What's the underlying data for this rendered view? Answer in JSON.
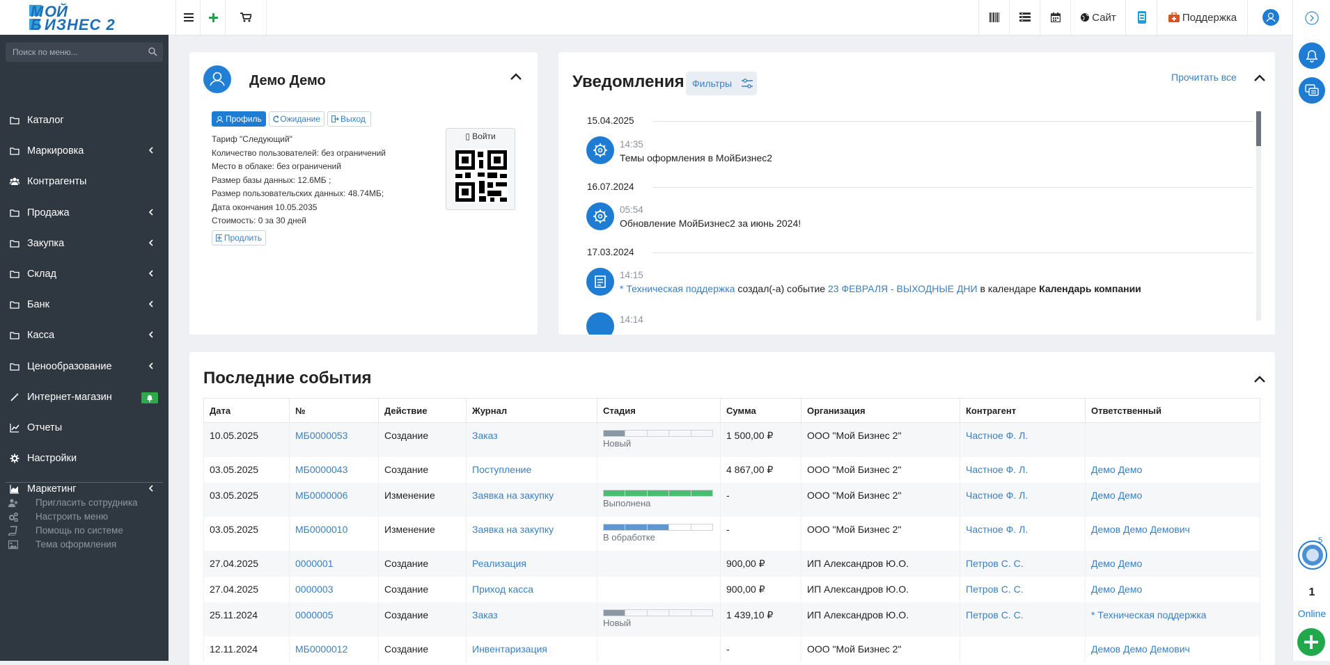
{
  "topbar": {
    "site_label": "Сайт",
    "support_label": "Поддержка"
  },
  "sidebar": {
    "search_placeholder": "Поиск по меню...",
    "items": [
      {
        "label": "Каталог",
        "icon": "folder-icon",
        "chevron": false
      },
      {
        "label": "Маркировка",
        "icon": "folder-icon",
        "chevron": true
      },
      {
        "label": "Контрагенты",
        "icon": "users-icon",
        "chevron": false
      },
      {
        "label": "Продажа",
        "icon": "folder-icon",
        "chevron": true
      },
      {
        "label": "Закупка",
        "icon": "folder-icon",
        "chevron": true
      },
      {
        "label": "Склад",
        "icon": "folder-icon",
        "chevron": true
      },
      {
        "label": "Банк",
        "icon": "folder-icon",
        "chevron": true
      },
      {
        "label": "Касса",
        "icon": "folder-icon",
        "chevron": true
      },
      {
        "label": "Ценообразование",
        "icon": "folder-icon",
        "chevron": true
      },
      {
        "label": "Интернет-магазин",
        "icon": "magic-wand-icon",
        "chevron": false
      },
      {
        "label": "Отчеты",
        "icon": "line-chart-icon",
        "chevron": false
      },
      {
        "label": "Настройки",
        "icon": "gear-icon",
        "chevron": false
      },
      {
        "label": "Маркетинг",
        "icon": "area-chart-icon",
        "chevron": true
      }
    ],
    "sub_items": [
      {
        "label": "Пригласить сотрудника",
        "icon": "user-plus-icon"
      },
      {
        "label": "Настроить меню",
        "icon": "gears-icon"
      },
      {
        "label": "Помощь по системе",
        "icon": "book-icon"
      },
      {
        "label": "Тема оформления",
        "icon": "image-icon"
      }
    ]
  },
  "profile": {
    "name": "Демо Демо",
    "btn_profile": "Профиль",
    "btn_wait": "Ожидание",
    "btn_exit": "Выход",
    "lines": [
      "Тариф \"Следующий\"",
      "Количество пользователей: без ограничений",
      "Место в облаке: без ограничений",
      "Размер базы данных: 12.6МБ ;",
      "Размер пользовательских данных: 48.74МБ;",
      "Дата окончания 10.05.2035",
      "Стоимость: 0 за 30 дней"
    ],
    "btn_extend": "Продлить",
    "qr_label": "Войти"
  },
  "notifications": {
    "title": "Уведомления",
    "filters_label": "Фильтры",
    "read_all": "Прочитать все",
    "groups": [
      {
        "date": "15.04.2025",
        "time": "14:35",
        "text": "Темы оформления в МойБизнес2"
      },
      {
        "date": "16.07.2024",
        "time": "05:54",
        "text": "Обновление МойБизнес2 за июнь 2024!"
      },
      {
        "date": "17.03.2024",
        "time": "14:15",
        "link1": "* Техническая поддержка",
        "mid1": "создал(-а) событие",
        "link2": "23 ФЕВРАЛЯ - ВЫХОДНЫЕ ДНИ",
        "mid2": "в календаре",
        "bold": "Календарь компании"
      },
      {
        "time": "14:14"
      }
    ]
  },
  "events": {
    "title": "Последние события",
    "columns": [
      "Дата",
      "№",
      "Действие",
      "Журнал",
      "Стадия",
      "Сумма",
      "Организация",
      "Контрагент",
      "Ответственный"
    ],
    "rows": [
      {
        "date": "10.05.2025",
        "num": "МБ0000053",
        "action": "Создание",
        "journal": "Заказ",
        "stage": "Новый",
        "stage_progress": 0.2,
        "stage_color": "#8a97a4",
        "sum": "1 500,00 ₽",
        "org": "ООО \"Мой Бизнес 2\"",
        "contractor": "Частное Ф. Л.",
        "responsible": ""
      },
      {
        "date": "03.05.2025",
        "num": "МБ0000043",
        "action": "Создание",
        "journal": "Поступление",
        "stage": "",
        "stage_progress": 0,
        "stage_color": "",
        "sum": "4 867,00 ₽",
        "org": "ООО \"Мой Бизнес 2\"",
        "contractor": "Частное Ф. Л.",
        "responsible": "Демо Демо"
      },
      {
        "date": "03.05.2025",
        "num": "МБ0000006",
        "action": "Изменение",
        "journal": "Заявка на закупку",
        "stage": "Выполнена",
        "stage_progress": 1.0,
        "stage_color": "#4cbd70",
        "sum": "-",
        "org": "ООО \"Мой Бизнес 2\"",
        "contractor": "Частное Ф. Л.",
        "responsible": "Демо Демо"
      },
      {
        "date": "03.05.2025",
        "num": "МБ0000010",
        "action": "Изменение",
        "journal": "Заявка на закупку",
        "stage": "В обработке",
        "stage_progress": 0.67,
        "stage_color": "#5a99d6",
        "sum": "-",
        "org": "ООО \"Мой Бизнес 2\"",
        "contractor": "Частное Ф. Л.",
        "responsible": "Демов Демо Демович"
      },
      {
        "date": "27.04.2025",
        "num": "0000001",
        "action": "Создание",
        "journal": "Реализация",
        "stage": "",
        "stage_progress": 0,
        "stage_color": "",
        "sum": "900,00 ₽",
        "org": "ИП Александров Ю.О.",
        "contractor": "Петров С. С.",
        "responsible": "Демо Демо"
      },
      {
        "date": "27.04.2025",
        "num": "0000003",
        "action": "Создание",
        "journal": "Приход касса",
        "stage": "",
        "stage_progress": 0,
        "stage_color": "",
        "sum": "900,00 ₽",
        "org": "ИП Александров Ю.О.",
        "contractor": "Петров С. С.",
        "responsible": "Демо Демо"
      },
      {
        "date": "25.11.2024",
        "num": "0000005",
        "action": "Создание",
        "journal": "Заказ",
        "stage": "Новый",
        "stage_progress": 0.2,
        "stage_color": "#8a97a4",
        "sum": "1 439,10 ₽",
        "org": "ИП Александров Ю.О.",
        "contractor": "Петров С. С.",
        "responsible": "* Техническая поддержка"
      },
      {
        "date": "12.11.2024",
        "num": "МБ0000012",
        "action": "Создание",
        "journal": "Инвентаризация",
        "stage": "",
        "stage_progress": 0,
        "stage_color": "",
        "sum": "-",
        "org": "ООО \"Мой Бизнес 2\"",
        "contractor": "",
        "responsible": "Демов Демо Демович"
      }
    ]
  },
  "right_rail": {
    "chat_badge": "5",
    "online_count": "1",
    "online_label": "Online"
  },
  "colors": {
    "accent": "#1f7cd3",
    "sidebar": "#2f3740",
    "green": "#20a84a"
  }
}
